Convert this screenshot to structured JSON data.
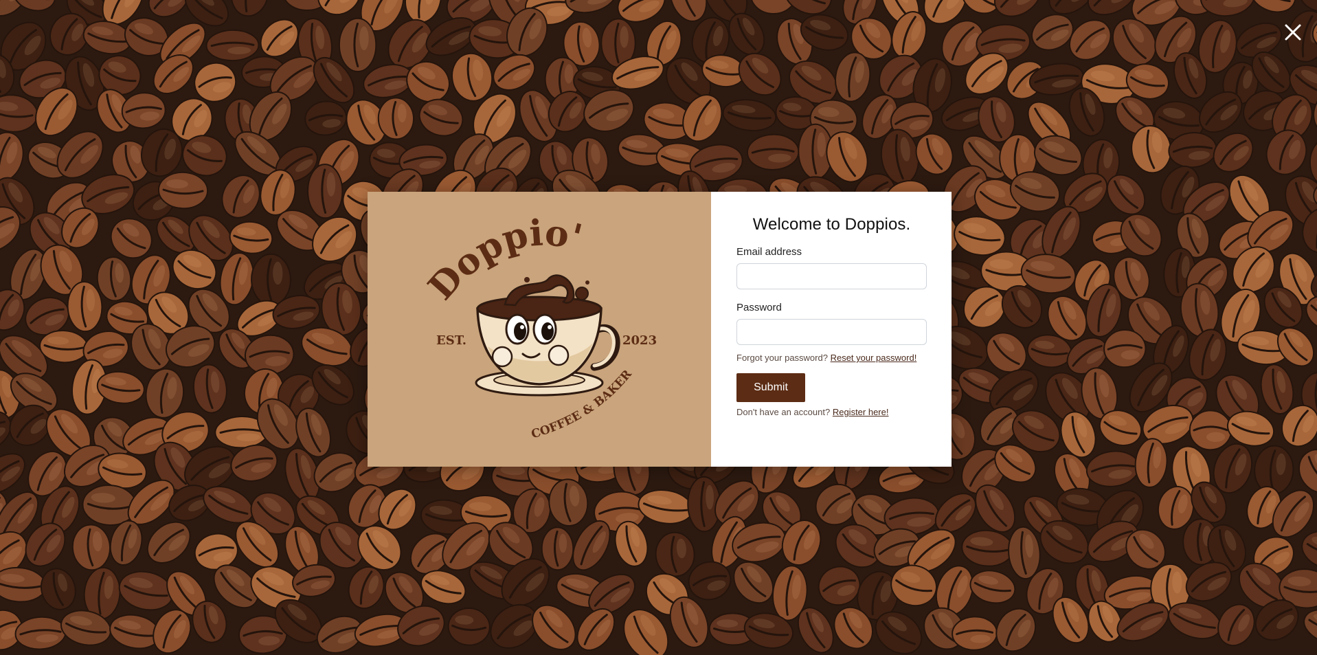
{
  "modal": {
    "title": "Welcome to Doppios.",
    "email_label": "Email address",
    "email_value": "",
    "password_label": "Password",
    "password_value": "",
    "forgot_text": "Forgot your password?",
    "reset_link": "Reset your password!",
    "submit_label": "Submit",
    "register_text": "Don't have an account?",
    "register_link": "Register here!"
  },
  "logo": {
    "brand": "Doppio's",
    "est": "EST.",
    "year": "2023",
    "tagline": "COFFEE & BAKERY"
  },
  "colors": {
    "logo_panel": "#c9a47c",
    "brand_brown": "#5c2c14",
    "background": "#3a2418"
  },
  "icons": {
    "close": "close-icon",
    "mascot": "coffee-cup-mascot-icon"
  }
}
